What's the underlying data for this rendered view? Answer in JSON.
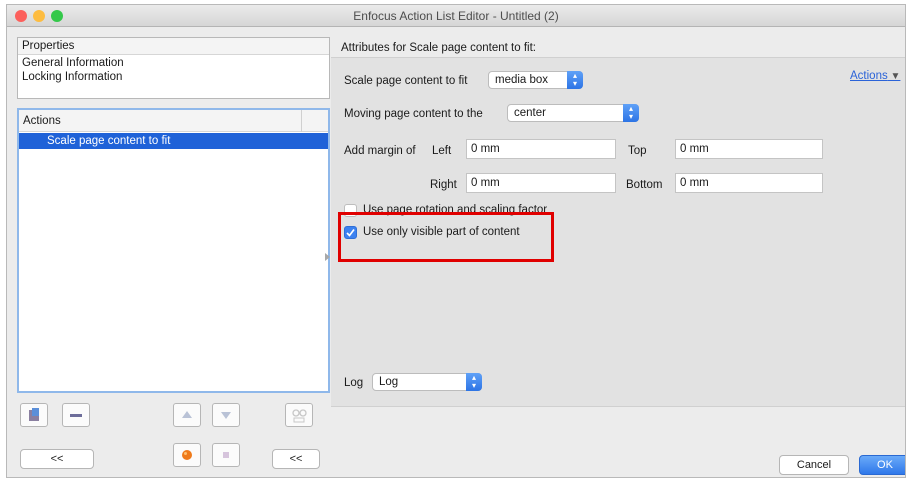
{
  "window": {
    "title": "Enfocus Action List Editor - Untitled (2)",
    "traffic_lights": [
      "#fc605c",
      "#fdbc40",
      "#34c84a"
    ]
  },
  "properties": {
    "header": "Properties",
    "items": [
      "General Information",
      "Locking Information"
    ]
  },
  "actions": {
    "header": "Actions",
    "items": [
      {
        "label": "Scale page content to fit",
        "selected": true
      }
    ]
  },
  "toolbar": {
    "collapse_left_label": "<<",
    "collapse_right_label": "<<"
  },
  "attributes": {
    "title": "Attributes for Scale page content to fit:",
    "actions_menu_label": "Actions",
    "scale_label": "Scale page content to fit",
    "scale_value": "media box",
    "moving_label": "Moving page content to the",
    "moving_value": "center",
    "margin": {
      "label": "Add margin of",
      "left_label": "Left",
      "left_value": "0 mm",
      "top_label": "Top",
      "top_value": "0 mm",
      "right_label": "Right",
      "right_value": "0 mm",
      "bottom_label": "Bottom",
      "bottom_value": "0 mm"
    },
    "rotation_checkbox_label": "Use page rotation and scaling factor",
    "rotation_checked": false,
    "visible_checkbox_label": "Use only visible part of content",
    "visible_checked": true,
    "log_label": "Log",
    "log_value": "Log"
  },
  "footer": {
    "cancel_label": "Cancel",
    "ok_label": "OK"
  },
  "colors": {
    "accent": "#1f62d8",
    "highlight": "#e00000"
  }
}
